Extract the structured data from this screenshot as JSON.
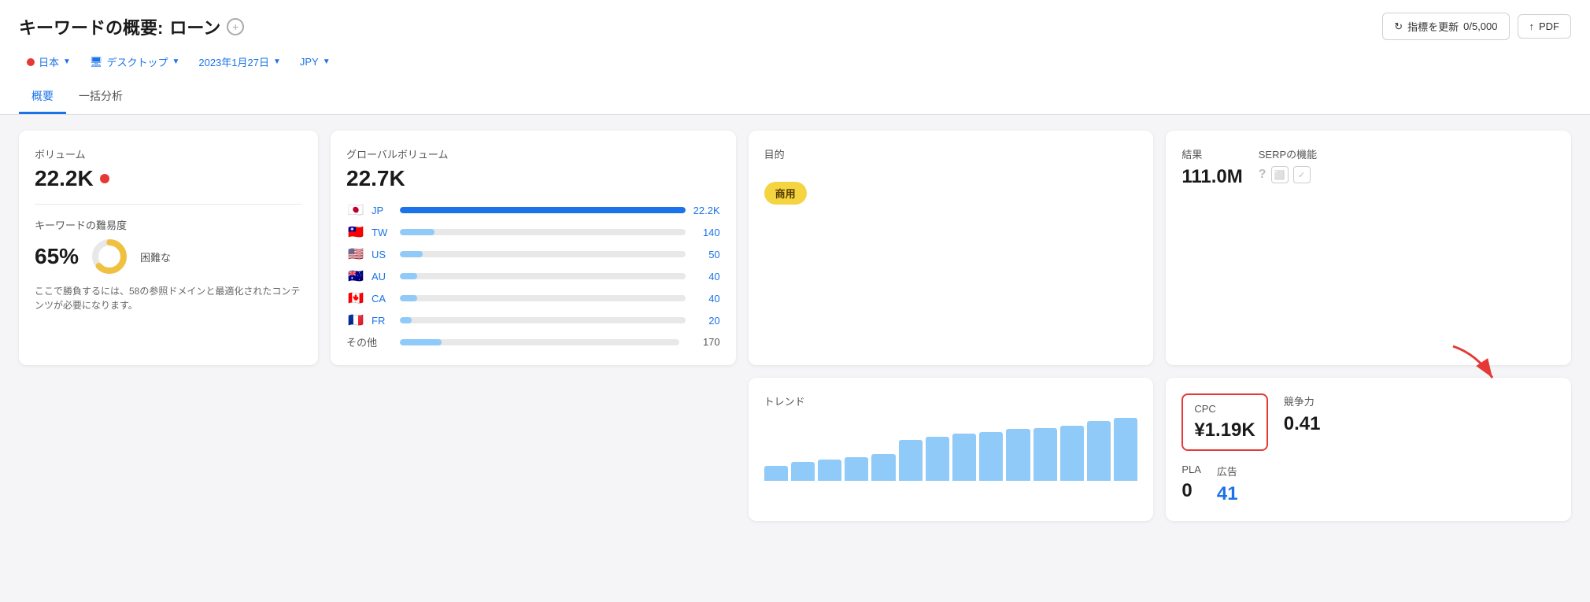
{
  "header": {
    "title_prefix": "キーワードの概要:",
    "title_keyword": "ローン",
    "refresh_label": "指標を更新",
    "refresh_count": "0/5,000",
    "pdf_label": "PDF",
    "filter_country": "日本",
    "filter_device": "デスクトップ",
    "filter_date": "2023年1月27日",
    "filter_currency": "JPY",
    "tab_overview": "概要",
    "tab_bulk": "一括分析"
  },
  "card_volume": {
    "label": "ボリューム",
    "value": "22.2K",
    "difficulty_label": "キーワードの難易度",
    "difficulty_pct": "65%",
    "difficulty_sub": "困難な",
    "difficulty_desc": "ここで勝負するには、58の参照ドメインと最適化されたコンテンツが必要になります。"
  },
  "card_global": {
    "label": "グローバルボリューム",
    "value": "22.7K",
    "countries": [
      {
        "flag": "🇯🇵",
        "code": "JP",
        "count": "22.2K",
        "pct": 100,
        "color": "blue"
      },
      {
        "flag": "🇹🇼",
        "code": "TW",
        "count": "140",
        "pct": 12,
        "color": "light"
      },
      {
        "flag": "🇺🇸",
        "code": "US",
        "count": "50",
        "pct": 8,
        "color": "light"
      },
      {
        "flag": "🇦🇺",
        "code": "AU",
        "count": "40",
        "pct": 6,
        "color": "light"
      },
      {
        "flag": "🇨🇦",
        "code": "CA",
        "count": "40",
        "pct": 6,
        "color": "light"
      },
      {
        "flag": "🇫🇷",
        "code": "FR",
        "count": "20",
        "pct": 4,
        "color": "light"
      }
    ],
    "other_label": "その他",
    "other_count": "170"
  },
  "card_purpose": {
    "label": "目的",
    "badge": "商用"
  },
  "card_results": {
    "results_label": "結果",
    "results_value": "111.0M",
    "serp_label": "SERPの機能"
  },
  "card_trends": {
    "label": "トレンド",
    "bars": [
      20,
      25,
      28,
      32,
      35,
      55,
      58,
      62,
      65,
      68,
      70,
      75,
      80,
      85
    ]
  },
  "card_cpc": {
    "cpc_label": "CPC",
    "cpc_value": "¥1.19K",
    "competition_label": "競争力",
    "competition_value": "0.41",
    "pla_label": "PLA",
    "pla_value": "0",
    "ads_label": "広告",
    "ads_value": "41"
  }
}
